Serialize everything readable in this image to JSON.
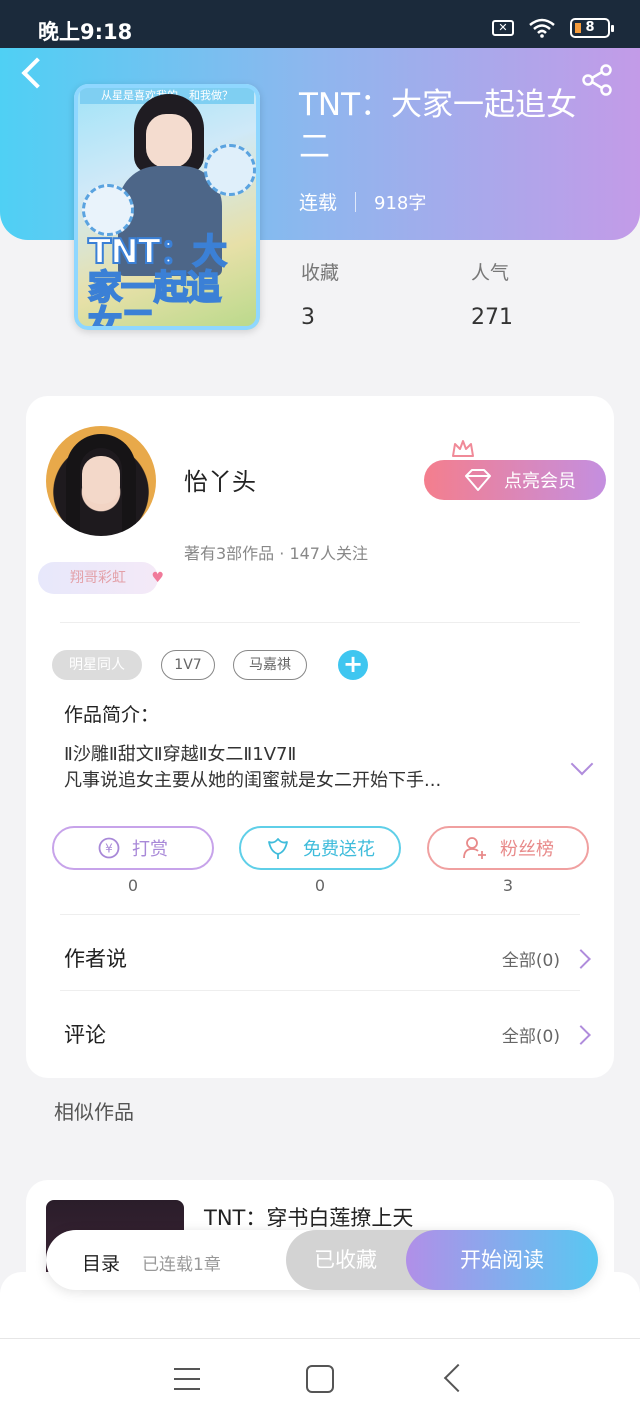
{
  "status_bar": {
    "time": "晚上9:18",
    "battery": "8"
  },
  "book": {
    "title": "TNT：大家一起追女二",
    "status": "连载",
    "word_count": "918字",
    "cover_title": "TNT：大家一起追女二",
    "cover_strip": "从星是喜欢我的，和我做？"
  },
  "stats": [
    {
      "label": "收藏",
      "value": "3"
    },
    {
      "label": "人气",
      "value": "271"
    }
  ],
  "author": {
    "name": "怡丫头",
    "meta": "著有3部作品 · 147人关注",
    "badge": "翔哥彩虹",
    "vip_button": "点亮会员"
  },
  "tags": [
    "明星同人",
    "1V7",
    "马嘉祺"
  ],
  "intro": {
    "label": "作品简介：",
    "line1": "Ⅱ沙雕Ⅱ甜文Ⅱ穿越Ⅱ女二Ⅱ1V7Ⅱ",
    "line2": "凡事说追女主要从她的闺蜜就是女二开始下手..."
  },
  "actions": [
    {
      "label": "打赏",
      "count": "0",
      "icon": "yen-circle-icon"
    },
    {
      "label": "免费送花",
      "count": "0",
      "icon": "flower-icon"
    },
    {
      "label": "粉丝榜",
      "count": "3",
      "icon": "fans-user-icon"
    }
  ],
  "rows": [
    {
      "label": "作者说",
      "right": "全部(0)"
    },
    {
      "label": "评论",
      "right": "全部(0)"
    }
  ],
  "similar": {
    "heading": "相似作品",
    "items": [
      {
        "title": "TNT：穿书白莲撩上天"
      }
    ]
  },
  "bottom_bar": {
    "toc": "目录",
    "toc_sub": "已连载1章",
    "saved": "已收藏",
    "read": "开始阅读"
  },
  "colors": {
    "banner_start": "#4fd0f4",
    "banner_end": "#c39be8",
    "accent_purple": "#b08cdc",
    "accent_cyan": "#3fc6f0"
  }
}
